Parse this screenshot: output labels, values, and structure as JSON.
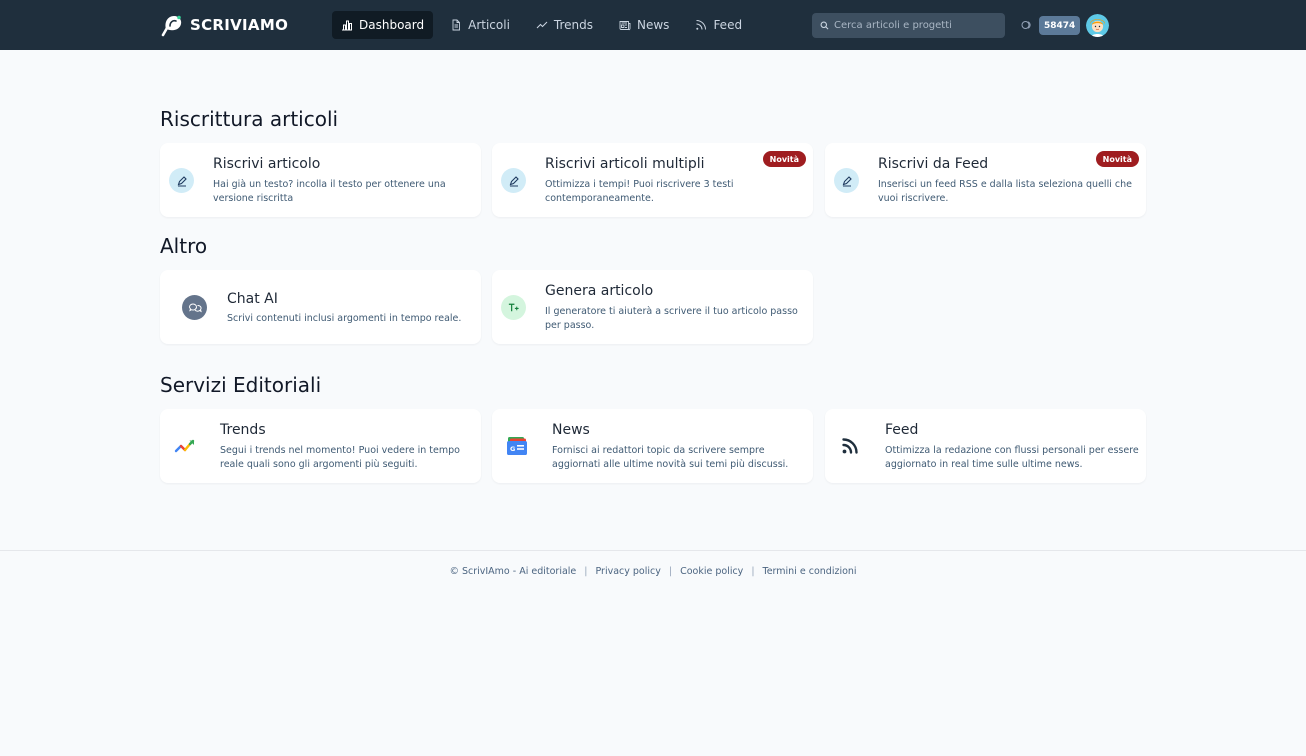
{
  "brand": {
    "name": "SCRIVIAMO"
  },
  "nav": {
    "items": [
      {
        "label": "Dashboard",
        "icon": "chart-bars-icon",
        "active": true
      },
      {
        "label": "Articoli",
        "icon": "document-icon"
      },
      {
        "label": "Trends",
        "icon": "trend-line-icon"
      },
      {
        "label": "News",
        "icon": "newspaper-icon"
      },
      {
        "label": "Feed",
        "icon": "rss-icon"
      }
    ]
  },
  "search": {
    "placeholder": "Cerca articoli e progetti",
    "value": ""
  },
  "credits": {
    "value": "58474",
    "icon": "coins-icon"
  },
  "sections": {
    "rewrite": {
      "title": "Riscrittura articoli",
      "cards": [
        {
          "title": "Riscrivi articolo",
          "desc_line1": "Hai già un testo? incolla il testo per ottenere una",
          "desc_line2": "versione riscritta",
          "icon": "edit-pen-icon"
        },
        {
          "title": "Riscrivi articoli multipli",
          "desc_line1": "Ottimizza i tempi! Puoi riscrivere 3 testi",
          "desc_line2": "contemporaneamente.",
          "badge": "Novità",
          "icon": "edit-pen-icon"
        },
        {
          "title": "Riscrivi da Feed",
          "desc_line1": "Inserisci un feed RSS e dalla lista seleziona quelli che",
          "desc_line2": "vuoi riscrivere.",
          "badge": "Novità",
          "icon": "edit-pen-icon"
        }
      ]
    },
    "other": {
      "title": "Altro",
      "cards": [
        {
          "title": "Chat AI",
          "desc_line1": "Scrivi contenuti inclusi argomenti in tempo reale.",
          "icon": "chat-bubbles-icon"
        },
        {
          "title": "Genera articolo",
          "desc_line1": "Il generatore ti aiuterà a scrivere il tuo articolo passo",
          "desc_line2": "per passo.",
          "icon": "text-sparkle-icon"
        }
      ]
    },
    "editorial": {
      "title": "Servizi Editoriali",
      "cards": [
        {
          "title": "Trends",
          "desc_line1": "Segui i trends nel momento! Puoi vedere in tempo",
          "desc_line2": "reale quali sono gli argomenti più seguiti.",
          "icon": "google-trends-icon"
        },
        {
          "title": "News",
          "desc_line1": "Fornisci ai redattori topic da scrivere sempre",
          "desc_line2": "aggiornati alle ultime novità sui temi più discussi.",
          "icon": "google-news-icon"
        },
        {
          "title": "Feed",
          "desc_line1": "Ottimizza la redazione con flussi personali per essere",
          "desc_line2": "aggiornato in real time sulle ultime news.",
          "icon": "rss-feed-icon"
        }
      ]
    }
  },
  "footer": {
    "copyright": "© ScrivIAmo - Ai editoriale",
    "links": [
      "Privacy policy",
      "Cookie policy",
      "Termini e condizioni"
    ],
    "separator": "|"
  },
  "colors": {
    "navbar": "#1f2f3d",
    "badge": "#9f1d20",
    "background": "#f8fafc",
    "credits_badge": "#5c7a99"
  }
}
